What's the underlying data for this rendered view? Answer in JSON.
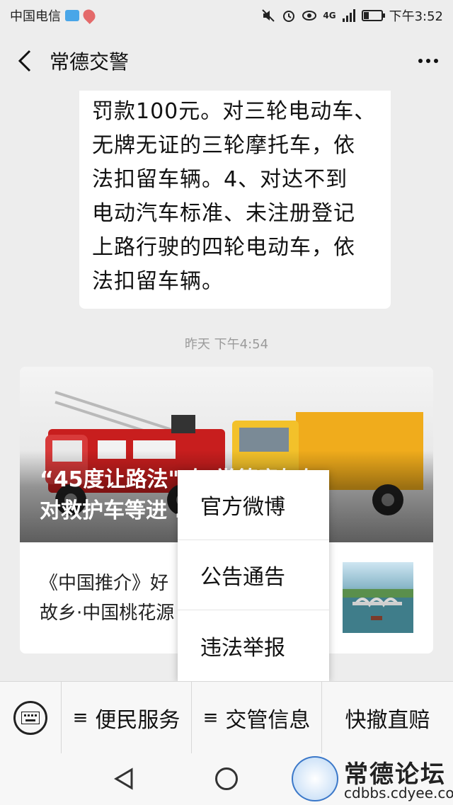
{
  "status_bar": {
    "carrier": "中国电信",
    "network": "4G",
    "time": "下午3:52",
    "battery_level": 0.3
  },
  "header": {
    "title": "常德交警"
  },
  "message": {
    "lines": [
      "罚款100元。对三轮电动车、",
      "无牌无证的三轮摩托车，依",
      "法扣留车辆。4、对达不到",
      "电动汽车标准、未注册登记",
      "上路行驶的四轮电动车，依",
      "法扣留车辆。"
    ]
  },
  "timestamp": "昨天 下午4:54",
  "article": {
    "cover_title_line1": "“45度让路法\"  在  常德竟如何",
    "cover_title_line2": "对救护车等进 ...                ？看...",
    "sub_title_line1": "《中国推介》好",
    "sub_title_line2": "故乡·中国桃花源"
  },
  "popup_menu": {
    "items": [
      "官方微博",
      "公告通告",
      "违法举报"
    ]
  },
  "bottom_menu": {
    "item1": "便民服务",
    "item2": "交管信息",
    "item3": "快撤直赔",
    "menu_marker": "≡"
  },
  "watermark": {
    "name": "常德论坛",
    "url": "cdbbs.cdyee.com"
  },
  "colors": {
    "background": "#ededed",
    "bubble": "#ffffff",
    "timestamp": "#9b9b9b"
  },
  "icons": {
    "back": "chevron-left-icon",
    "more": "more-dots-icon",
    "keyboard": "keyboard-icon",
    "nav_back": "triangle-back-icon",
    "nav_home": "circle-home-icon",
    "nav_recent": "square-recent-icon"
  }
}
